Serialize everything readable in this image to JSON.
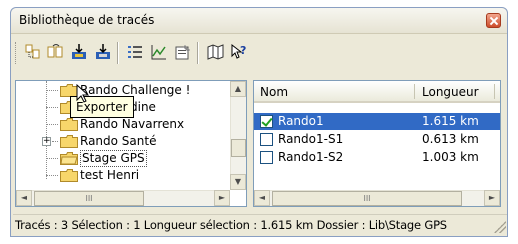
{
  "window": {
    "title": "Bibliothèque de tracés"
  },
  "toolbar": {
    "buttons": [
      "add-track-icon",
      "export-icon",
      "import-gps-icon",
      "download-icon",
      "list-view-icon",
      "profile-chart-icon",
      "properties-icon",
      "map-icon",
      "help-icon"
    ]
  },
  "tooltip": {
    "text": "Exporter"
  },
  "tree": {
    "items": [
      {
        "label": "Rando Challenge !"
      },
      {
        "label": "citadine"
      },
      {
        "label": "Rando Navarrenx"
      },
      {
        "label": "Rando Santé"
      },
      {
        "label": "Stage GPS"
      },
      {
        "label": "test Henri"
      }
    ],
    "expander_symbol": "+"
  },
  "list": {
    "headers": {
      "name": "Nom",
      "length": "Longueur"
    },
    "rows": [
      {
        "name": "Rando1",
        "length": "1.615 km",
        "checked": true,
        "selected": true
      },
      {
        "name": "Rando1-S1",
        "length": "0.613 km",
        "checked": false,
        "selected": false
      },
      {
        "name": "Rando1-S2",
        "length": "1.003 km",
        "checked": false,
        "selected": false
      }
    ]
  },
  "scroll": {
    "left": "◄",
    "right": "►",
    "up": "▲",
    "down": "▼",
    "thumb": "III"
  },
  "status": {
    "text": "Tracés : 3 Sélection : 1 Longueur sélection : 1.615 km Dossier : Lib\\Stage GPS"
  },
  "colors": {
    "selection": "#316ac5",
    "window_bg": "#ece9d8",
    "close": "#cc4c2b"
  }
}
